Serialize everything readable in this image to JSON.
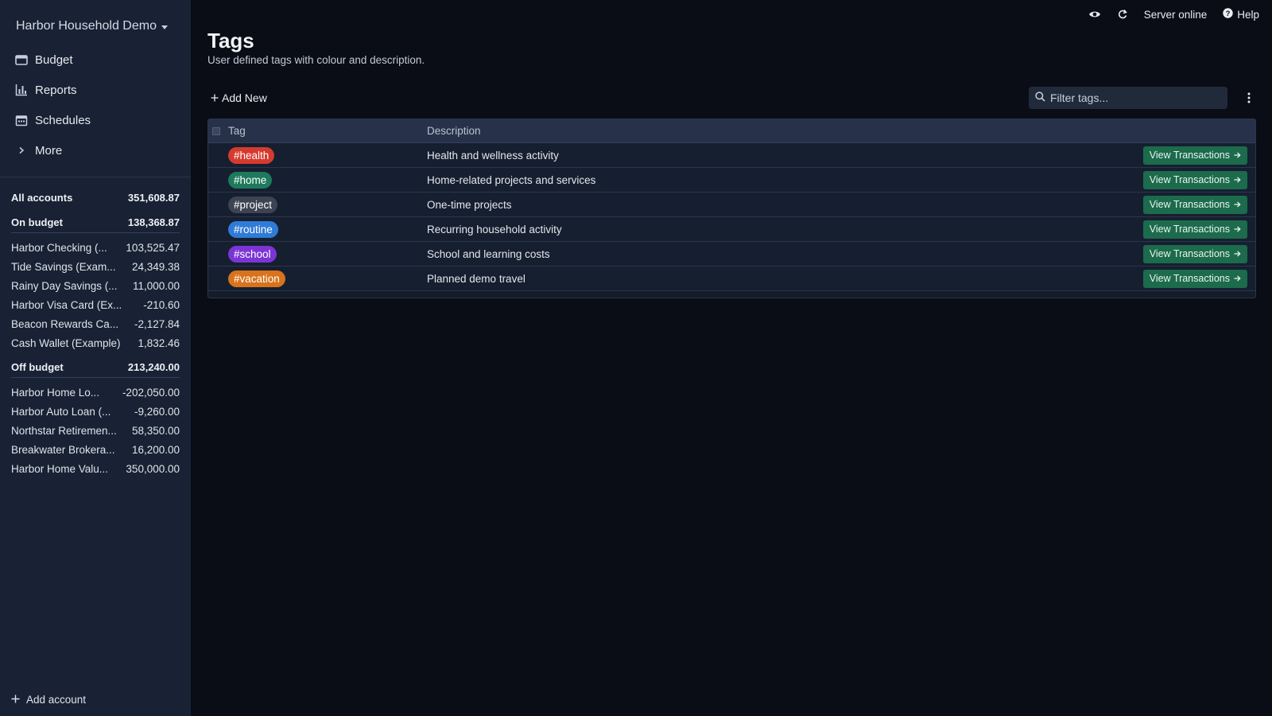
{
  "sidebar": {
    "budget_name": "Harbor Household Demo",
    "nav": [
      {
        "label": "Budget",
        "icon": "wallet-icon"
      },
      {
        "label": "Reports",
        "icon": "bar-chart-icon"
      },
      {
        "label": "Schedules",
        "icon": "calendar-icon"
      },
      {
        "label": "More",
        "icon": "chevron-right-icon"
      }
    ],
    "all_accounts": {
      "label": "All accounts",
      "balance": "351,608.87"
    },
    "on_budget": {
      "label": "On budget",
      "balance": "138,368.87",
      "accounts": [
        {
          "name": "Harbor Checking (...",
          "balance": "103,525.47"
        },
        {
          "name": "Tide Savings (Exam...",
          "balance": "24,349.38"
        },
        {
          "name": "Rainy Day Savings (...",
          "balance": "11,000.00"
        },
        {
          "name": "Harbor Visa Card (Ex...",
          "balance": "-210.60"
        },
        {
          "name": "Beacon Rewards Ca...",
          "balance": "-2,127.84"
        },
        {
          "name": "Cash Wallet (Example)",
          "balance": "1,832.46"
        }
      ]
    },
    "off_budget": {
      "label": "Off budget",
      "balance": "213,240.00",
      "accounts": [
        {
          "name": "Harbor Home Lo...",
          "balance": "-202,050.00"
        },
        {
          "name": "Harbor Auto Loan (...",
          "balance": "-9,260.00"
        },
        {
          "name": "Northstar Retiremen...",
          "balance": "58,350.00"
        },
        {
          "name": "Breakwater Brokera...",
          "balance": "16,200.00"
        },
        {
          "name": "Harbor Home Valu...",
          "balance": "350,000.00"
        }
      ]
    },
    "add_account": "Add account"
  },
  "topbar": {
    "server_status": "Server online",
    "help": "Help"
  },
  "page": {
    "title": "Tags",
    "subtitle": "User defined tags with colour and description.",
    "add_new": "Add New",
    "filter_placeholder": "Filter tags...",
    "columns": {
      "tag": "Tag",
      "description": "Description"
    },
    "view_label": "View Transactions",
    "rows": [
      {
        "tag": "#health",
        "color": "#d63a2f",
        "description": "Health and wellness activity"
      },
      {
        "tag": "#home",
        "color": "#1d7a5c",
        "description": "Home-related projects and services"
      },
      {
        "tag": "#project",
        "color": "#3d4352",
        "description": "One-time projects"
      },
      {
        "tag": "#routine",
        "color": "#2f7bd8",
        "description": "Recurring household activity"
      },
      {
        "tag": "#school",
        "color": "#7b35d6",
        "description": "School and learning costs"
      },
      {
        "tag": "#vacation",
        "color": "#d8731c",
        "description": "Planned demo travel"
      }
    ]
  },
  "colors": {
    "sidebar_bg": "#182234",
    "main_bg": "#0a0d16",
    "button_green": "#1c6b4c"
  }
}
